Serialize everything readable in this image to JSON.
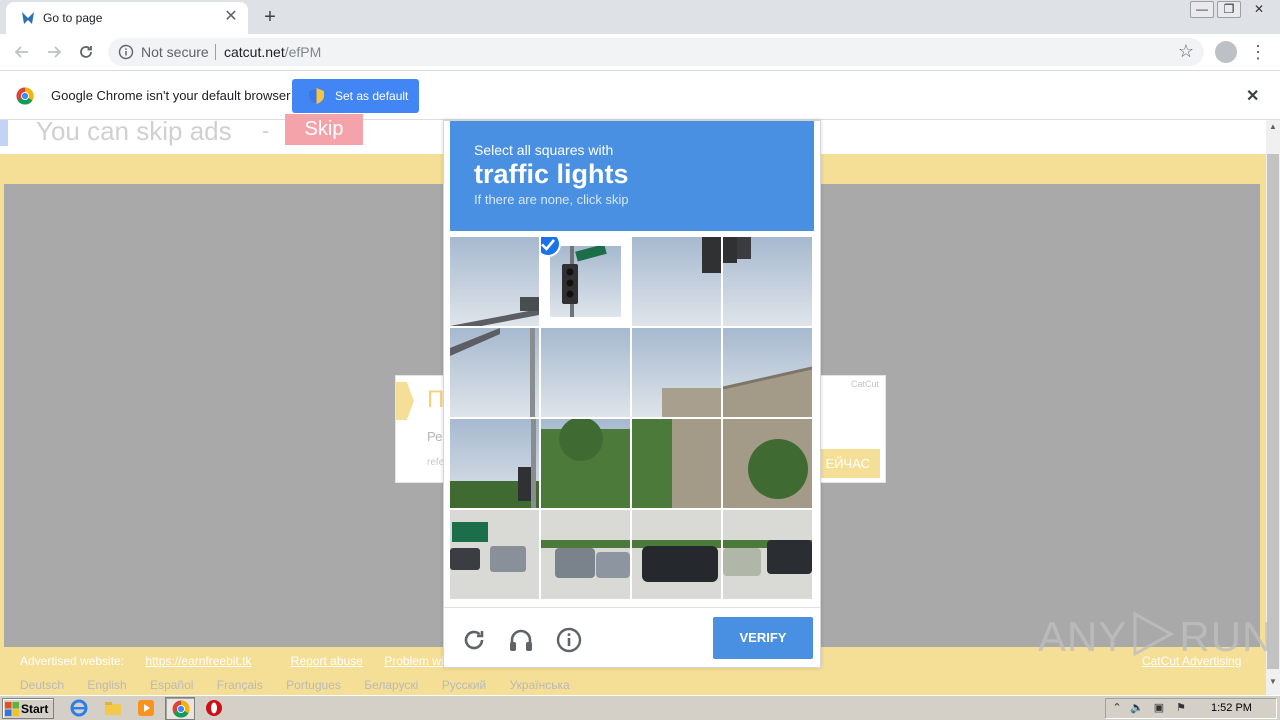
{
  "browser": {
    "tab_title": "Go to page",
    "tab_close": "✕",
    "new_tab": "+",
    "url_security": "Not secure",
    "url_host": "catcut.net",
    "url_path": "/efPM",
    "window_buttons": [
      "—",
      "❐",
      "✕"
    ]
  },
  "infobar": {
    "message": "Google Chrome isn't your default browser",
    "button_label": "Set as default",
    "close": "✕"
  },
  "page": {
    "skip_text": "You can skip ads",
    "skip_dash": "-",
    "skip_button": "Skip",
    "ad_heading": "П",
    "ad_line1": "Ре",
    "ad_line2": "refe",
    "ad_brand": "CatCut",
    "ad_cta": "ЕЙЧАС",
    "footer_advertised": "Advertised website: ",
    "footer_advertised_link": "https://earnfreebit.tk",
    "footer_report": "Report abuse",
    "footer_problem": "Problem with the",
    "footer_right": "CatCut Advertising",
    "languages": [
      "Deutsch",
      "English",
      "Español",
      "Français",
      "Portugues",
      "Беларускі",
      "Русский",
      "Українська"
    ]
  },
  "captcha": {
    "instruction": "Select all squares with",
    "target": "traffic lights",
    "hint": "If there are none, click skip",
    "verify_label": "VERIFY",
    "selected_tiles": [
      1
    ]
  },
  "watermark": {
    "left": "ANY",
    "right": "RUN"
  },
  "taskbar": {
    "start_label": "Start",
    "clock": "1:52 PM"
  },
  "colors": {
    "captcha_blue": "#4a90e2",
    "chrome_blue": "#4285f4",
    "catcut_yellow": "#f5df96",
    "skip_pink": "#f5a3ab"
  }
}
